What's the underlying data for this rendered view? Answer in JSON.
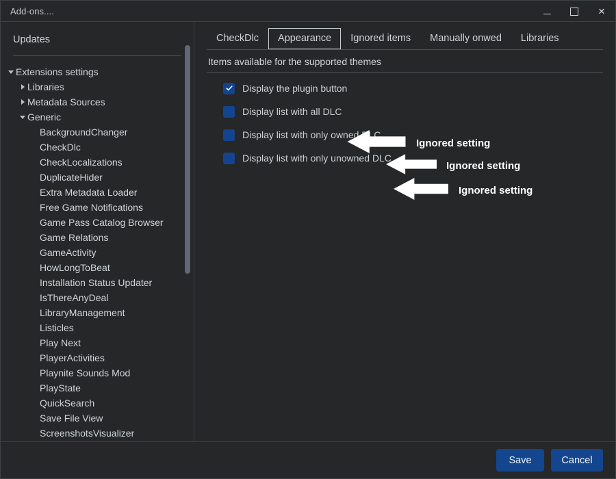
{
  "window": {
    "title": "Add-ons....",
    "controls": {
      "minimize": "minimize-icon",
      "maximize": "maximize-icon",
      "close": "×"
    }
  },
  "sidebar": {
    "updates_label": "Updates",
    "tree": [
      {
        "label": "Extensions settings",
        "level": 0,
        "state": "expanded"
      },
      {
        "label": "Libraries",
        "level": 1,
        "state": "collapsed"
      },
      {
        "label": "Metadata Sources",
        "level": 1,
        "state": "collapsed"
      },
      {
        "label": "Generic",
        "level": 1,
        "state": "expanded"
      },
      {
        "label": "BackgroundChanger",
        "level": 2,
        "state": "leaf"
      },
      {
        "label": "CheckDlc",
        "level": 2,
        "state": "leaf"
      },
      {
        "label": "CheckLocalizations",
        "level": 2,
        "state": "leaf"
      },
      {
        "label": "DuplicateHider",
        "level": 2,
        "state": "leaf"
      },
      {
        "label": "Extra Metadata Loader",
        "level": 2,
        "state": "leaf"
      },
      {
        "label": "Free Game Notifications",
        "level": 2,
        "state": "leaf"
      },
      {
        "label": "Game Pass Catalog Browser",
        "level": 2,
        "state": "leaf"
      },
      {
        "label": "Game Relations",
        "level": 2,
        "state": "leaf"
      },
      {
        "label": "GameActivity",
        "level": 2,
        "state": "leaf"
      },
      {
        "label": "HowLongToBeat",
        "level": 2,
        "state": "leaf"
      },
      {
        "label": "Installation Status Updater",
        "level": 2,
        "state": "leaf"
      },
      {
        "label": "IsThereAnyDeal",
        "level": 2,
        "state": "leaf"
      },
      {
        "label": "LibraryManagement",
        "level": 2,
        "state": "leaf"
      },
      {
        "label": "Listicles",
        "level": 2,
        "state": "leaf"
      },
      {
        "label": "Play Next",
        "level": 2,
        "state": "leaf"
      },
      {
        "label": "PlayerActivities",
        "level": 2,
        "state": "leaf"
      },
      {
        "label": "Playnite Sounds Mod",
        "level": 2,
        "state": "leaf"
      },
      {
        "label": "PlayState",
        "level": 2,
        "state": "leaf"
      },
      {
        "label": "QuickSearch",
        "level": 2,
        "state": "leaf"
      },
      {
        "label": "Save File View",
        "level": 2,
        "state": "leaf"
      },
      {
        "label": "ScreenshotsVisualizer",
        "level": 2,
        "state": "leaf"
      }
    ]
  },
  "main": {
    "tabs": [
      {
        "label": "CheckDlc",
        "selected": false
      },
      {
        "label": "Appearance",
        "selected": true
      },
      {
        "label": "Ignored items",
        "selected": false
      },
      {
        "label": "Manually onwed",
        "selected": false
      },
      {
        "label": "Libraries",
        "selected": false
      }
    ],
    "section_label": "Items available for the supported themes",
    "checkboxes": [
      {
        "label": "Display the plugin button",
        "checked": true
      },
      {
        "label": "Display list with all DLC",
        "checked": false
      },
      {
        "label": "Display list with only owned DLC",
        "checked": false
      },
      {
        "label": "Display list with only unowned DLC",
        "checked": false
      }
    ]
  },
  "annotations": [
    {
      "text": "Ignored setting",
      "icon": "left-arrow-icon"
    },
    {
      "text": "Ignored setting",
      "icon": "left-arrow-icon"
    },
    {
      "text": "Ignored setting",
      "icon": "left-arrow-icon"
    }
  ],
  "footer": {
    "save_label": "Save",
    "cancel_label": "Cancel"
  },
  "colors": {
    "window_bg": "#262729",
    "accent_blue": "#14458f",
    "text": "#cbd1d5",
    "divider": "#4a5054",
    "annotation": "#ffffff"
  }
}
